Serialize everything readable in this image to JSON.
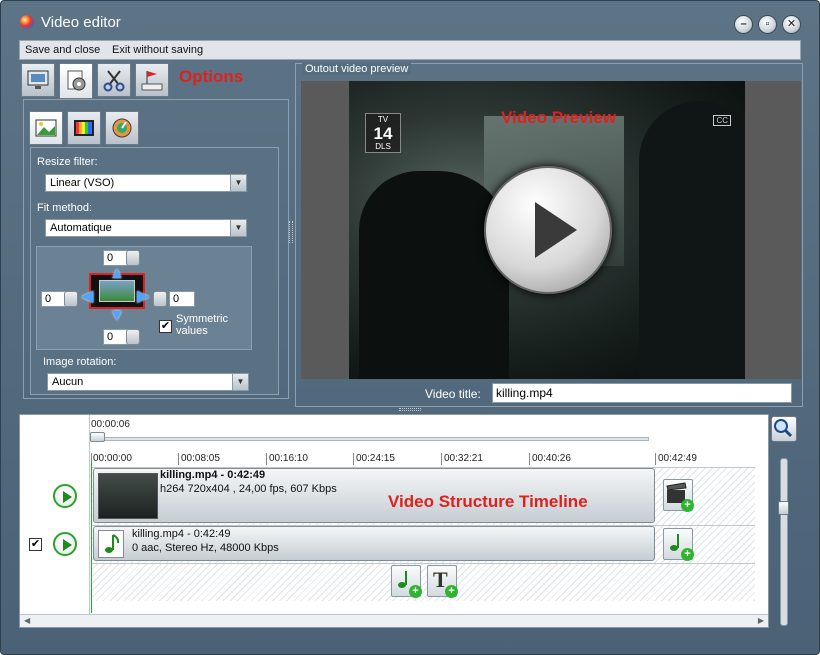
{
  "window": {
    "title": "Video editor"
  },
  "menu": {
    "save_close": "Save and close",
    "exit_no_save": "Exit without saving"
  },
  "left_panel": {
    "annotation": "Options",
    "resize_filter_label": "Resize filter:",
    "resize_filter_value": "Linear (VSO)",
    "fit_method_label": "Fit method:",
    "fit_method_value": "Automatique",
    "crop": {
      "top": "0",
      "left": "0",
      "right": "0",
      "bottom": "0"
    },
    "symmetric_label": "Symmetric values",
    "symmetric_checked": true,
    "rotation_label": "Image rotation:",
    "rotation_value": "Aucun"
  },
  "preview": {
    "group_label": "Outout video preview",
    "annotation": "Video Preview",
    "tv_rating_top": "TV",
    "tv_rating_num": "14",
    "tv_rating_bottom": "DLS",
    "cc_badge": "CC",
    "title_label": "Video title:",
    "title_value": "killing.mp4"
  },
  "timeline": {
    "annotation": "Video Structure Timeline",
    "current_time": "00:00:06",
    "ruler": [
      "00:00:00",
      "00:08:05",
      "00:16:10",
      "00:24:15",
      "00:32:21",
      "00:40:26",
      "00:42:49"
    ],
    "video_clip": {
      "name": "killing.mp4 - 0:42:49",
      "info": "h264 720x404 , 24,00 fps, 607 Kbps"
    },
    "audio_clip": {
      "name": "killing.mp4 - 0:42:49",
      "info": "0 aac, Stereo Hz, 48000 Kbps"
    },
    "audio_track_checked": true
  }
}
